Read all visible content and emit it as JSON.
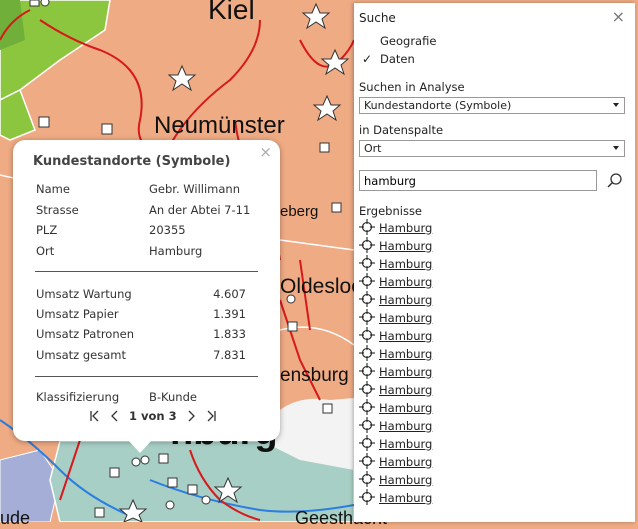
{
  "map": {
    "labels": [
      "Kiel",
      "Neumünster",
      "eberg",
      "Oldesloe",
      "ensburg",
      "nburg",
      "Geesthacht",
      "ude"
    ]
  },
  "popup": {
    "title": "Kundestandorte (Symbole)",
    "close_icon": "×",
    "info": [
      {
        "key": "Name",
        "value": "Gebr. Willimann"
      },
      {
        "key": "Strasse",
        "value": "An der Abtei 7-11"
      },
      {
        "key": "PLZ",
        "value": "20355"
      },
      {
        "key": "Ort",
        "value": "Hamburg"
      }
    ],
    "sales": [
      {
        "key": "Umsatz Wartung",
        "value": "4.607"
      },
      {
        "key": "Umsatz Papier",
        "value": "1.391"
      },
      {
        "key": "Umsatz Patronen",
        "value": "1.833"
      },
      {
        "key": "Umsatz gesamt",
        "value": "7.831"
      }
    ],
    "classification": {
      "key": "Klassifizierung",
      "value": "B-Kunde"
    },
    "pager": {
      "label": "1 von 3"
    }
  },
  "panel": {
    "title": "Suche",
    "close_icon": "×",
    "options": [
      "Geografie",
      "Daten"
    ],
    "selected_option": "Daten",
    "search_in_label": "Suchen in Analyse",
    "search_in_value": "Kundestandorte (Symbole)",
    "column_label": "in Datenspalte",
    "column_value": "Ort",
    "search_value": "hamburg",
    "results_label": "Ergebnisse",
    "results": [
      "Hamburg",
      "Hamburg",
      "Hamburg",
      "Hamburg",
      "Hamburg",
      "Hamburg",
      "Hamburg",
      "Hamburg",
      "Hamburg",
      "Hamburg",
      "Hamburg",
      "Hamburg",
      "Hamburg",
      "Hamburg",
      "Hamburg",
      "Hamburg"
    ]
  }
}
